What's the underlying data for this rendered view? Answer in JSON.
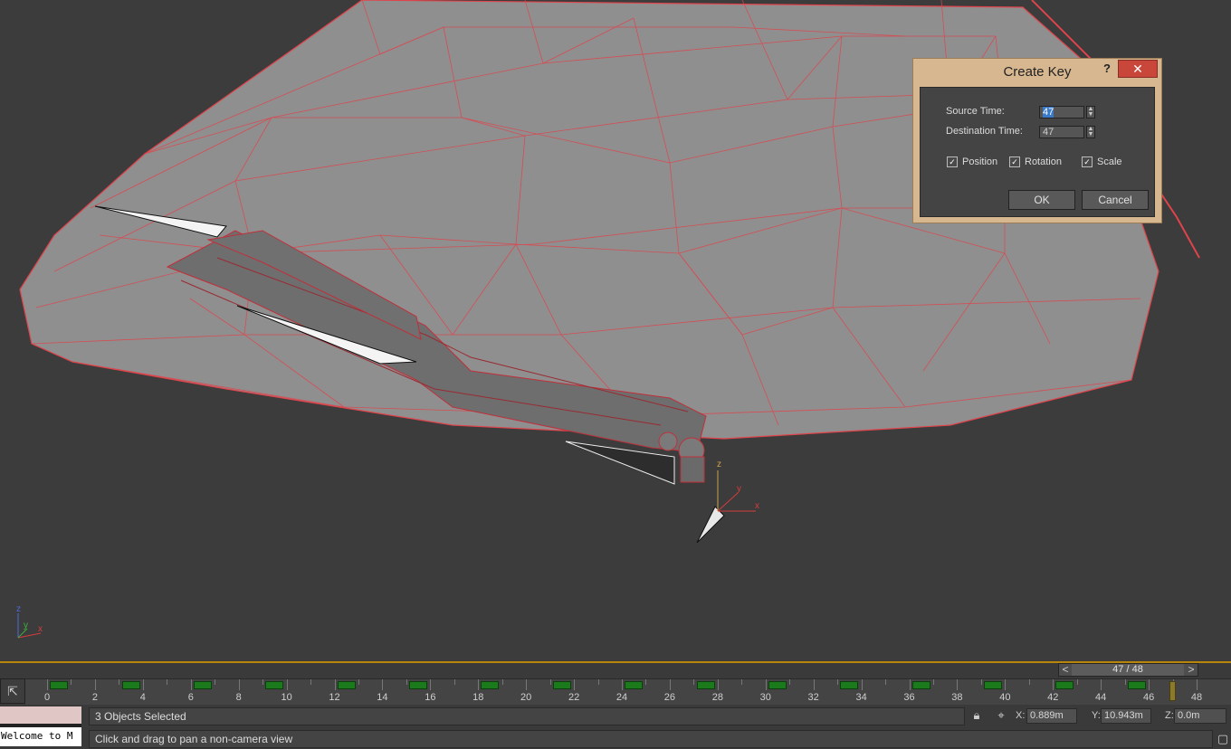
{
  "dialog": {
    "title": "Create Key",
    "help_label": "?",
    "close_label": "✕",
    "source_time_label": "Source Time:",
    "source_time_value": "47",
    "destination_time_label": "Destination Time:",
    "destination_time_value": "47",
    "checkboxes": [
      {
        "label": "Position",
        "checked": true
      },
      {
        "label": "Rotation",
        "checked": true
      },
      {
        "label": "Scale",
        "checked": true
      }
    ],
    "ok_label": "OK",
    "cancel_label": "Cancel"
  },
  "viewport": {
    "gizmo_axes": [
      "z",
      "x",
      "y"
    ],
    "mesh_color": "#e0434b"
  },
  "timeline": {
    "frame_display": "47 / 48",
    "prev_label": "<",
    "next_label": ">",
    "tick_labels": [
      "0",
      "2",
      "4",
      "6",
      "8",
      "10",
      "12",
      "14",
      "16",
      "18",
      "20",
      "22",
      "24",
      "26",
      "28",
      "30",
      "32",
      "34",
      "36",
      "38",
      "40",
      "42",
      "44",
      "46",
      "48"
    ]
  },
  "status": {
    "listener_text": "Welcome to M",
    "selection_text": "3 Objects Selected",
    "prompt_text": "Click and drag to pan a non-camera view",
    "coords": {
      "x_label": "X:",
      "x_value": "0.889m",
      "y_label": "Y:",
      "y_value": "10.943m",
      "z_label": "Z:",
      "z_value": "0.0m"
    }
  }
}
